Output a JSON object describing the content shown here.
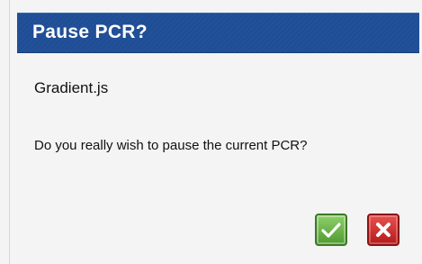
{
  "dialog": {
    "title": "Pause PCR?",
    "filename": "Gradient.js",
    "message": "Do you really wish to pause  the current PCR?"
  },
  "buttons": {
    "confirm": {
      "icon": "checkmark-icon",
      "color": "#5aa83a"
    },
    "cancel": {
      "icon": "close-x-icon",
      "color": "#d13030"
    }
  }
}
